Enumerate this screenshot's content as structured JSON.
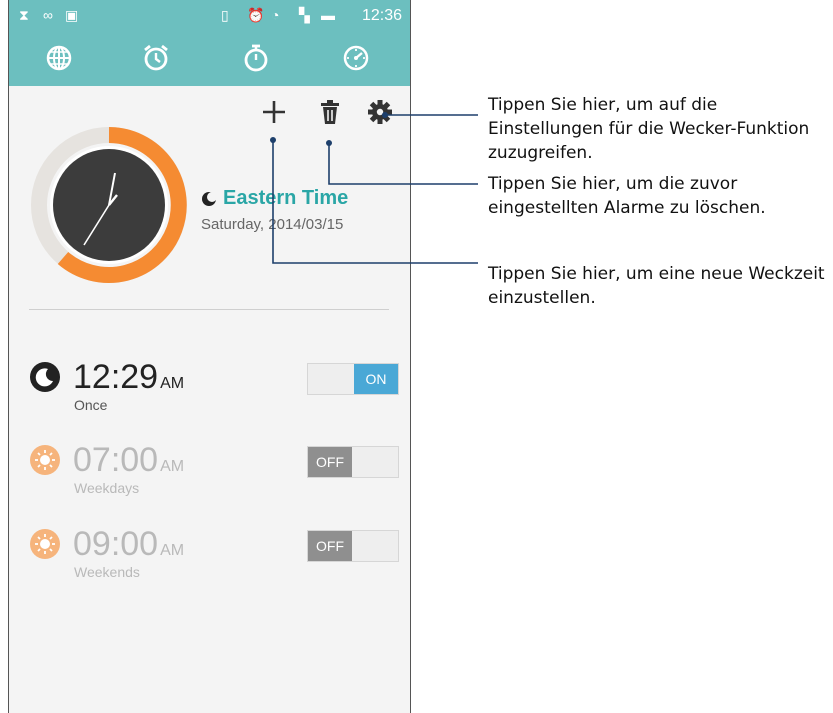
{
  "statusbar": {
    "time": "12:36"
  },
  "clock_world": {
    "timezone": "Eastern Time",
    "date": "Saturday, 2014/03/15"
  },
  "alarms": [
    {
      "time": "12:29",
      "ampm": "AM",
      "repeat": "Once",
      "state": "ON",
      "enabled": true
    },
    {
      "time": "07:00",
      "ampm": "AM",
      "repeat": "Weekdays",
      "state": "OFF",
      "enabled": false
    },
    {
      "time": "09:00",
      "ampm": "AM",
      "repeat": "Weekends",
      "state": "OFF",
      "enabled": false
    }
  ],
  "callouts": {
    "settings": [
      "Tippen Sie hier, um auf die",
      "Einstellungen für die Wecker-Funktion",
      "zuzugreifen."
    ],
    "delete": [
      "Tippen Sie hier, um die zuvor",
      "eingestellten Alarme zu löschen."
    ],
    "add": [
      "Tippen Sie hier, um eine neue Weckzeit",
      "einzustellen."
    ]
  },
  "colors": {
    "accent": "#6cbfbf",
    "zone_text": "#2aa6a6",
    "ring": "#f58b32",
    "toggle_on": "#4aa8d6",
    "toggle_off": "#8f8f8f"
  }
}
